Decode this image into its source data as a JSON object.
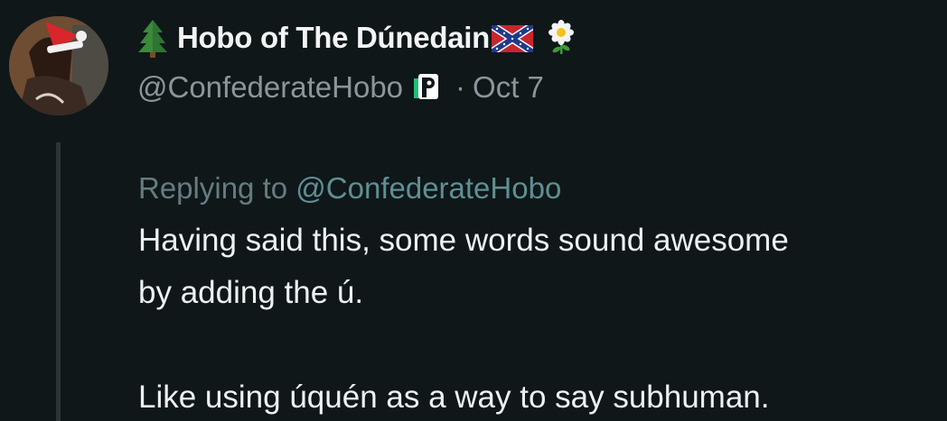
{
  "author": {
    "display_name": "Hobo of The Dúnedain",
    "handle": "@ConfederateHobo",
    "separator": "·",
    "date": "Oct 7",
    "icons": [
      "tree-emoji",
      "flag-emoji",
      "flower-emoji",
      "p-badge-icon"
    ]
  },
  "reply": {
    "prefix": "Replying to",
    "handle": "@ConfederateHobo"
  },
  "text": "Having said this, some words sound awesome\nby adding the ú.\n\nLike using úquén as a way to say subhuman.",
  "colors": {
    "background": "#0f1719",
    "muted": "#8a969b",
    "reply_handle": "#5f8f93",
    "thread_line": "#2c3437"
  }
}
